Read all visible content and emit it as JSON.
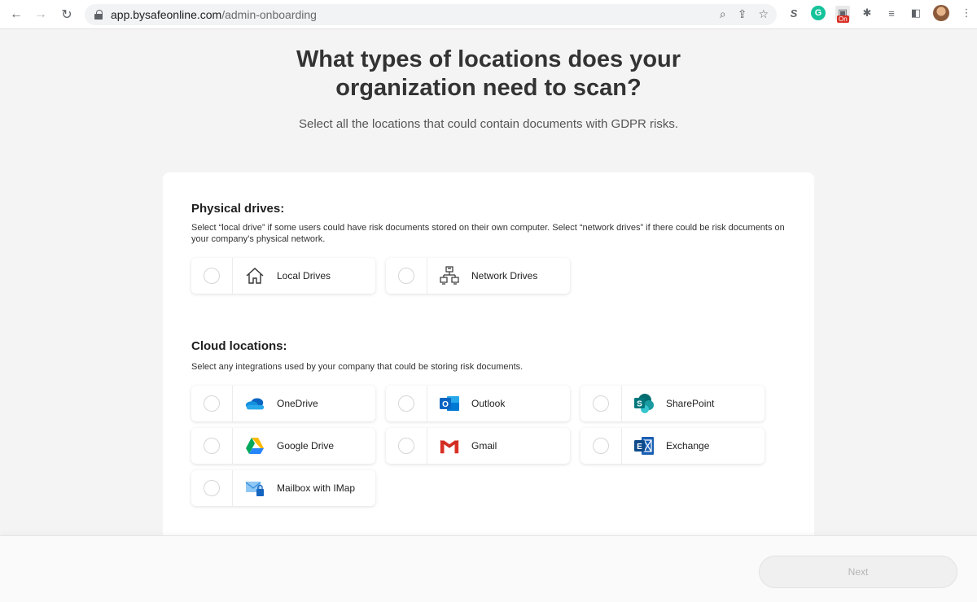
{
  "browser": {
    "url_host": "app.bysafeonline.com",
    "url_path": "/admin-onboarding",
    "rec_badge": "On"
  },
  "page": {
    "title_line1": "What types of locations does your",
    "title_line2": "organization need to scan?",
    "subtitle": "Select all the locations that could contain documents with GDPR risks."
  },
  "physical": {
    "title": "Physical drives:",
    "description": "Select “local drive” if some users could have risk documents stored on their own computer. Select “network drives” if there could be risk documents on your company’s physical network.",
    "options": [
      {
        "label": "Local Drives",
        "icon": "house-icon",
        "checked": false
      },
      {
        "label": "Network Drives",
        "icon": "network-icon",
        "checked": false
      }
    ]
  },
  "cloud": {
    "title": "Cloud locations:",
    "description": "Select any integrations used by your company that could be storing risk documents.",
    "options": [
      {
        "label": "OneDrive",
        "icon": "onedrive-icon",
        "checked": false
      },
      {
        "label": "Outlook",
        "icon": "outlook-icon",
        "checked": false
      },
      {
        "label": "SharePoint",
        "icon": "sharepoint-icon",
        "checked": false
      },
      {
        "label": "Google Drive",
        "icon": "google-drive-icon",
        "checked": false
      },
      {
        "label": "Gmail",
        "icon": "gmail-icon",
        "checked": false
      },
      {
        "label": "Exchange",
        "icon": "exchange-icon",
        "checked": false
      },
      {
        "label": "Mailbox with IMap",
        "icon": "mailbox-imap-icon",
        "checked": false
      }
    ]
  },
  "footer": {
    "next_label": "Next",
    "next_enabled": false
  },
  "colors": {
    "outlook": "#0a64c2",
    "sharepoint": "#077d7a",
    "onedrive": "#0f6fd1",
    "exchange": "#1a5fb4",
    "gmail": "#d93025"
  }
}
